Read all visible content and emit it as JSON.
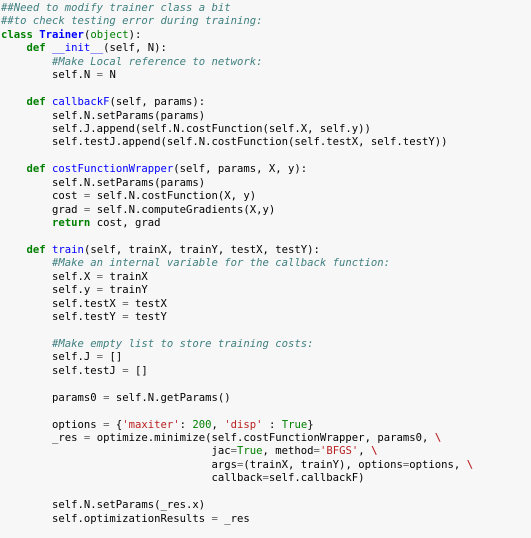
{
  "editor": {
    "kind": "python-code-block",
    "background_color": "#f7f7f7",
    "foreground_color": "#000000",
    "language": "Python",
    "colors": {
      "comment": "#408080",
      "keyword": "#008000",
      "class_name": "#0000ff",
      "function_name": "#0000ff",
      "builtin": "#008000",
      "string": "#ba2121",
      "number": "#008000",
      "operator": "#666666",
      "text": "#000000"
    }
  },
  "code": {
    "lines": [
      {
        "id": "line-1",
        "tokens": [
          {
            "cls": "t-c",
            "text": "##Need to modify trainer class a bit"
          }
        ]
      },
      {
        "id": "line-2",
        "tokens": [
          {
            "cls": "t-c",
            "text": "##to check testing error during training:"
          }
        ]
      },
      {
        "id": "line-3",
        "tokens": [
          {
            "cls": "t-k",
            "text": "class"
          },
          {
            "cls": "t-n",
            "text": " "
          },
          {
            "cls": "t-nc",
            "text": "Trainer"
          },
          {
            "cls": "t-p",
            "text": "("
          },
          {
            "cls": "t-nb",
            "text": "object"
          },
          {
            "cls": "t-p",
            "text": "):"
          }
        ]
      },
      {
        "id": "line-4",
        "tokens": [
          {
            "cls": "t-n",
            "text": "    "
          },
          {
            "cls": "t-k",
            "text": "def"
          },
          {
            "cls": "t-n",
            "text": " "
          },
          {
            "cls": "t-nf",
            "text": "__init__"
          },
          {
            "cls": "t-p",
            "text": "(self, N):"
          }
        ]
      },
      {
        "id": "line-5",
        "tokens": [
          {
            "cls": "t-n",
            "text": "        "
          },
          {
            "cls": "t-c",
            "text": "#Make Local reference to network:"
          }
        ]
      },
      {
        "id": "line-6",
        "tokens": [
          {
            "cls": "t-n",
            "text": "        self.N "
          },
          {
            "cls": "t-o",
            "text": "="
          },
          {
            "cls": "t-n",
            "text": " N"
          }
        ]
      },
      {
        "id": "line-7",
        "tokens": [
          {
            "cls": "t-n",
            "text": ""
          }
        ]
      },
      {
        "id": "line-8",
        "tokens": [
          {
            "cls": "t-n",
            "text": "    "
          },
          {
            "cls": "t-k",
            "text": "def"
          },
          {
            "cls": "t-n",
            "text": " "
          },
          {
            "cls": "t-nf",
            "text": "callbackF"
          },
          {
            "cls": "t-p",
            "text": "(self, params):"
          }
        ]
      },
      {
        "id": "line-9",
        "tokens": [
          {
            "cls": "t-n",
            "text": "        self.N.setParams(params)"
          }
        ]
      },
      {
        "id": "line-10",
        "tokens": [
          {
            "cls": "t-n",
            "text": "        self.J.append(self.N.costFunction(self.X, self.y))"
          }
        ]
      },
      {
        "id": "line-11",
        "tokens": [
          {
            "cls": "t-n",
            "text": "        self.testJ.append(self.N.costFunction(self.testX, self.testY))"
          }
        ]
      },
      {
        "id": "line-12",
        "tokens": [
          {
            "cls": "t-n",
            "text": ""
          }
        ]
      },
      {
        "id": "line-13",
        "tokens": [
          {
            "cls": "t-n",
            "text": "    "
          },
          {
            "cls": "t-k",
            "text": "def"
          },
          {
            "cls": "t-n",
            "text": " "
          },
          {
            "cls": "t-nf",
            "text": "costFunctionWrapper"
          },
          {
            "cls": "t-p",
            "text": "(self, params, X, y):"
          }
        ]
      },
      {
        "id": "line-14",
        "tokens": [
          {
            "cls": "t-n",
            "text": "        self.N.setParams(params)"
          }
        ]
      },
      {
        "id": "line-15",
        "tokens": [
          {
            "cls": "t-n",
            "text": "        cost "
          },
          {
            "cls": "t-o",
            "text": "="
          },
          {
            "cls": "t-n",
            "text": " self.N.costFunction(X, y)"
          }
        ]
      },
      {
        "id": "line-16",
        "tokens": [
          {
            "cls": "t-n",
            "text": "        grad "
          },
          {
            "cls": "t-o",
            "text": "="
          },
          {
            "cls": "t-n",
            "text": " self.N.computeGradients(X,y)"
          }
        ]
      },
      {
        "id": "line-17",
        "tokens": [
          {
            "cls": "t-n",
            "text": "        "
          },
          {
            "cls": "t-k",
            "text": "return"
          },
          {
            "cls": "t-n",
            "text": " cost, grad"
          }
        ]
      },
      {
        "id": "line-18",
        "tokens": [
          {
            "cls": "t-n",
            "text": ""
          }
        ]
      },
      {
        "id": "line-19",
        "tokens": [
          {
            "cls": "t-n",
            "text": "    "
          },
          {
            "cls": "t-k",
            "text": "def"
          },
          {
            "cls": "t-n",
            "text": " "
          },
          {
            "cls": "t-nf",
            "text": "train"
          },
          {
            "cls": "t-p",
            "text": "(self, trainX, trainY, testX, testY):"
          }
        ]
      },
      {
        "id": "line-20",
        "tokens": [
          {
            "cls": "t-n",
            "text": "        "
          },
          {
            "cls": "t-c",
            "text": "#Make an internal variable for the callback function:"
          }
        ]
      },
      {
        "id": "line-21",
        "tokens": [
          {
            "cls": "t-n",
            "text": "        self.X "
          },
          {
            "cls": "t-o",
            "text": "="
          },
          {
            "cls": "t-n",
            "text": " trainX"
          }
        ]
      },
      {
        "id": "line-22",
        "tokens": [
          {
            "cls": "t-n",
            "text": "        self.y "
          },
          {
            "cls": "t-o",
            "text": "="
          },
          {
            "cls": "t-n",
            "text": " trainY"
          }
        ]
      },
      {
        "id": "line-23",
        "tokens": [
          {
            "cls": "t-n",
            "text": "        self.testX "
          },
          {
            "cls": "t-o",
            "text": "="
          },
          {
            "cls": "t-n",
            "text": " testX"
          }
        ]
      },
      {
        "id": "line-24",
        "tokens": [
          {
            "cls": "t-n",
            "text": "        self.testY "
          },
          {
            "cls": "t-o",
            "text": "="
          },
          {
            "cls": "t-n",
            "text": " testY"
          }
        ]
      },
      {
        "id": "line-25",
        "tokens": [
          {
            "cls": "t-n",
            "text": ""
          }
        ]
      },
      {
        "id": "line-26",
        "tokens": [
          {
            "cls": "t-n",
            "text": "        "
          },
          {
            "cls": "t-c",
            "text": "#Make empty list to store training costs:"
          }
        ]
      },
      {
        "id": "line-27",
        "tokens": [
          {
            "cls": "t-n",
            "text": "        self.J "
          },
          {
            "cls": "t-o",
            "text": "="
          },
          {
            "cls": "t-n",
            "text": " []"
          }
        ]
      },
      {
        "id": "line-28",
        "tokens": [
          {
            "cls": "t-n",
            "text": "        self.testJ "
          },
          {
            "cls": "t-o",
            "text": "="
          },
          {
            "cls": "t-n",
            "text": " []"
          }
        ]
      },
      {
        "id": "line-29",
        "tokens": [
          {
            "cls": "t-n",
            "text": ""
          }
        ]
      },
      {
        "id": "line-30",
        "tokens": [
          {
            "cls": "t-n",
            "text": "        params0 "
          },
          {
            "cls": "t-o",
            "text": "="
          },
          {
            "cls": "t-n",
            "text": " self.N.getParams()"
          }
        ]
      },
      {
        "id": "line-31",
        "tokens": [
          {
            "cls": "t-n",
            "text": ""
          }
        ]
      },
      {
        "id": "line-32",
        "tokens": [
          {
            "cls": "t-n",
            "text": "        options "
          },
          {
            "cls": "t-o",
            "text": "="
          },
          {
            "cls": "t-n",
            "text": " {"
          },
          {
            "cls": "t-s",
            "text": "'maxiter'"
          },
          {
            "cls": "t-n",
            "text": ": "
          },
          {
            "cls": "t-mi",
            "text": "200"
          },
          {
            "cls": "t-n",
            "text": ", "
          },
          {
            "cls": "t-s",
            "text": "'disp'"
          },
          {
            "cls": "t-n",
            "text": " : "
          },
          {
            "cls": "t-bp",
            "text": "True"
          },
          {
            "cls": "t-n",
            "text": "}"
          }
        ]
      },
      {
        "id": "line-33",
        "tokens": [
          {
            "cls": "t-n",
            "text": "        _res "
          },
          {
            "cls": "t-o",
            "text": "="
          },
          {
            "cls": "t-n",
            "text": " optimize.minimize(self.costFunctionWrapper, params0, "
          },
          {
            "cls": "t-se",
            "text": "\\"
          }
        ]
      },
      {
        "id": "line-34",
        "tokens": [
          {
            "cls": "t-n",
            "text": "                                 jac"
          },
          {
            "cls": "t-o",
            "text": "="
          },
          {
            "cls": "t-bp",
            "text": "True"
          },
          {
            "cls": "t-n",
            "text": ", method"
          },
          {
            "cls": "t-o",
            "text": "="
          },
          {
            "cls": "t-s",
            "text": "'BFGS'"
          },
          {
            "cls": "t-n",
            "text": ", "
          },
          {
            "cls": "t-se",
            "text": "\\"
          }
        ]
      },
      {
        "id": "line-35",
        "tokens": [
          {
            "cls": "t-n",
            "text": "                                 args"
          },
          {
            "cls": "t-o",
            "text": "="
          },
          {
            "cls": "t-n",
            "text": "(trainX, trainY), options"
          },
          {
            "cls": "t-o",
            "text": "="
          },
          {
            "cls": "t-n",
            "text": "options, "
          },
          {
            "cls": "t-se",
            "text": "\\"
          }
        ]
      },
      {
        "id": "line-36",
        "tokens": [
          {
            "cls": "t-n",
            "text": "                                 callback"
          },
          {
            "cls": "t-o",
            "text": "="
          },
          {
            "cls": "t-n",
            "text": "self.callbackF)"
          }
        ]
      },
      {
        "id": "line-37",
        "tokens": [
          {
            "cls": "t-n",
            "text": ""
          }
        ]
      },
      {
        "id": "line-38",
        "tokens": [
          {
            "cls": "t-n",
            "text": "        self.N.setParams(_res.x)"
          }
        ]
      },
      {
        "id": "line-39",
        "tokens": [
          {
            "cls": "t-n",
            "text": "        self.optimizationResults "
          },
          {
            "cls": "t-o",
            "text": "="
          },
          {
            "cls": "t-n",
            "text": " _res"
          }
        ]
      }
    ]
  }
}
